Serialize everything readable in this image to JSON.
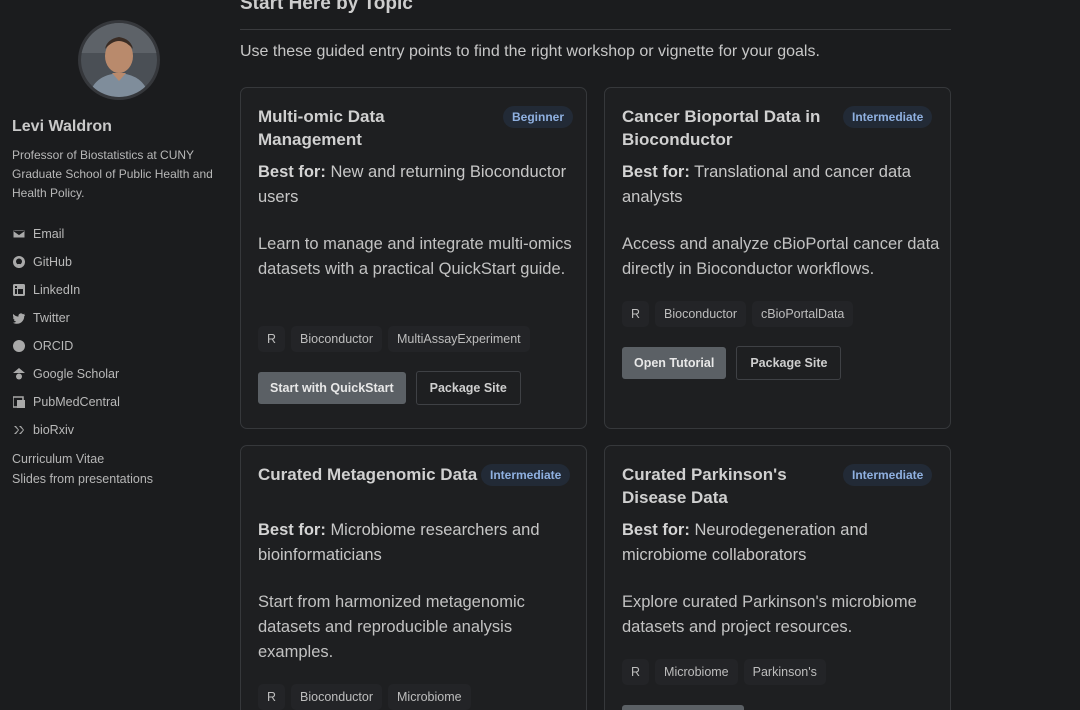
{
  "sidebar": {
    "name": "Levi Waldron",
    "bio": "Professor of Biostatistics at CUNY Graduate School of Public Health and Health Policy.",
    "links": [
      {
        "label": "Email",
        "icon": "envelope-icon"
      },
      {
        "label": "GitHub",
        "icon": "github-icon"
      },
      {
        "label": "LinkedIn",
        "icon": "linkedin-icon"
      },
      {
        "label": "Twitter",
        "icon": "twitter-icon"
      },
      {
        "label": "ORCID",
        "icon": "orcid-icon"
      },
      {
        "label": "Google Scholar",
        "icon": "google-scholar-icon"
      },
      {
        "label": "PubMedCentral",
        "icon": "pubmedcentral-icon"
      },
      {
        "label": "bioRxiv",
        "icon": "biorxiv-icon"
      }
    ],
    "cv_label": "Curriculum Vitae",
    "slides_label": "Slides from presentations"
  },
  "main": {
    "title": "Start Here by Topic",
    "intro": "Use these guided entry points to find the right workshop or vignette for your goals.",
    "cards": [
      {
        "title": "Multi-omic Data Management",
        "level": "Beginner",
        "best_label": "Best for:",
        "best_for": "New and returning Bioconductor users",
        "description": "Learn to manage and integrate multi-omics datasets with a practical QuickStart guide.",
        "tags": [
          "R",
          "Bioconductor",
          "MultiAssayExperiment"
        ],
        "primary_button": "Start with QuickStart",
        "secondary_button": "Package Site"
      },
      {
        "title": "Cancer Bioportal Data in Bioconductor",
        "level": "Intermediate",
        "best_label": "Best for:",
        "best_for": "Translational and cancer data analysts",
        "description": "Access and analyze cBioPortal cancer data directly in Bioconductor workflows.",
        "tags": [
          "R",
          "Bioconductor",
          "cBioPortalData"
        ],
        "primary_button": "Open Tutorial",
        "secondary_button": "Package Site"
      },
      {
        "title": "Curated Metagenomic Data",
        "level": "Intermediate",
        "best_label": "Best for:",
        "best_for": "Microbiome researchers and bioinformaticians",
        "description": "Start from harmonized metagenomic datasets and reproducible analysis examples.",
        "tags": [
          "R",
          "Bioconductor",
          "Microbiome"
        ]
      },
      {
        "title": "Curated Parkinson's Disease Data",
        "level": "Intermediate",
        "best_label": "Best for:",
        "best_for": "Neurodegeneration and microbiome collaborators",
        "description": "Explore curated Parkinson's microbiome datasets and project resources.",
        "tags": [
          "R",
          "Microbiome",
          "Parkinson's"
        ]
      }
    ]
  }
}
